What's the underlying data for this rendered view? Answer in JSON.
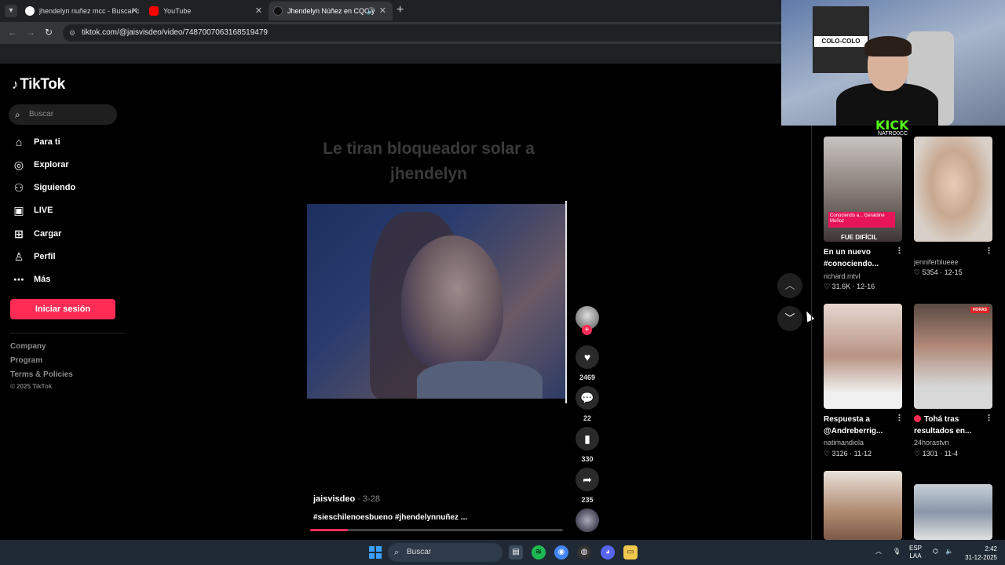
{
  "browser": {
    "tabs": [
      {
        "title": "jhendelyn nuñez mcc - Buscar c"
      },
      {
        "title": "YouTube"
      },
      {
        "title": "Jhendelyn Núñez en CQC y"
      }
    ],
    "new_tab": "+",
    "url": "tiktok.com/@jaisvisdeo/video/7487007063168519479"
  },
  "tiktok": {
    "logo": "TikTok",
    "search_placeholder": "Buscar",
    "nav": [
      {
        "label": "Para ti",
        "icon": "home-icon"
      },
      {
        "label": "Explorar",
        "icon": "compass-icon"
      },
      {
        "label": "Siguiendo",
        "icon": "following-icon"
      },
      {
        "label": "LIVE",
        "icon": "live-icon"
      },
      {
        "label": "Cargar",
        "icon": "upload-icon"
      },
      {
        "label": "Perfil",
        "icon": "profile-icon"
      },
      {
        "label": "Más",
        "icon": "more-icon"
      }
    ],
    "login": "Iniciar sesión",
    "footer": [
      "Company",
      "Program",
      "Terms & Policies"
    ],
    "copyright": "© 2025 TikTok"
  },
  "video": {
    "overlay_title": "Le tiran bloqueador solar a jhendelyn",
    "author": "jaisvisdeo",
    "date": "· 3-28",
    "tags": "#sieschilenoesbueno #jhendelynnuñez ...",
    "progress": 0.15,
    "likes": "2469",
    "comments": "22",
    "saves": "330",
    "shares": "235",
    "follow_plus": "+"
  },
  "webcam": {
    "overlay_brand": "KICK",
    "overlay_user": "NATRO0CC",
    "flag_text": "COLO-COLO"
  },
  "recommended": [
    {
      "caption": "En un nuevo #conociendo...",
      "user": "richard.mtvl",
      "likes": "31.6K",
      "date": "12-16",
      "badge": "Conociendo a... Geraldine Muñoz",
      "overlay": "FUE DIFÍCIL"
    },
    {
      "caption": "",
      "user": "jenniferblueee",
      "likes": "5354",
      "date": "12-15"
    },
    {
      "caption": "Respuesta a @Andreberrig...",
      "user": "natimandiola",
      "likes": "3126",
      "date": "11-12"
    },
    {
      "caption": "Tohá tras resultados en...",
      "user": "24horastvn",
      "likes": "1301",
      "date": "11-4",
      "live": "HORAS"
    }
  ],
  "taskbar": {
    "search": "Buscar",
    "lang_top": "ESP",
    "lang_bottom": "LAA",
    "time": "2:42",
    "date": "31-12-2025"
  },
  "colors": {
    "accent": "#fe2c55",
    "background": "#000000"
  }
}
